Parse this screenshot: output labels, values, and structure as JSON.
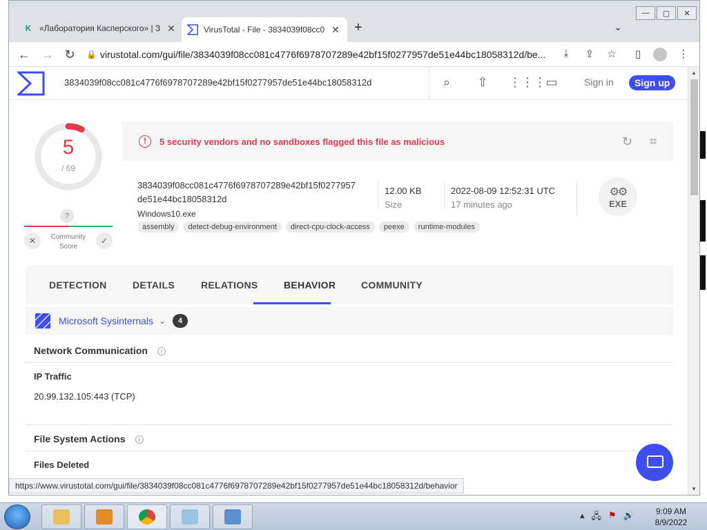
{
  "browser": {
    "tabs": [
      {
        "title": "«Лаборатория Касперского» | З",
        "favicon": "K"
      },
      {
        "title": "VirusTotal - File - 3834039f08cc0",
        "favicon": "vt-logo"
      }
    ],
    "url": "virustotal.com/gui/file/3834039f08cc081c4776f6978707289e42bf15f0277957de51e44bc18058312d/be...",
    "status_url": "https://www.virustotal.com/gui/file/3834039f08cc081c4776f6978707289e42bf15f0277957de51e44bc18058312d/behavior"
  },
  "vt": {
    "search_value": "3834039f08cc081c4776f6978707289e42bf15f0277957de51e44bc18058312d",
    "sign_in": "Sign in",
    "sign_up": "Sign up",
    "score": {
      "detected": "5",
      "total": "/ 69",
      "fraction": 0.072
    },
    "community": {
      "question": "?",
      "label_line1": "Community",
      "label_line2": "Score"
    },
    "alert_text": "5 security vendors and no sandboxes flagged this file as malicious",
    "file": {
      "hash_line1": "3834039f08cc081c4776f6978707289e42bf15f0277957",
      "hash_line2": "de51e44bc18058312d",
      "name": "Windows10.exe",
      "tags": [
        "assembly",
        "detect-debug-environment",
        "direct-cpu-clock-access",
        "peexe",
        "runtime-modules"
      ],
      "size_value": "12.00 KB",
      "size_label": "Size",
      "date_value": "2022-08-09 12:52:31 UTC",
      "date_ago": "17 minutes ago",
      "type_label": "EXE"
    },
    "nav_tabs": [
      "DETECTION",
      "DETAILS",
      "RELATIONS",
      "BEHAVIOR",
      "COMMUNITY"
    ],
    "active_tab": "BEHAVIOR",
    "sandbox": {
      "name": "Microsoft Sysinternals",
      "count": "4"
    },
    "sections": {
      "network_title": "Network Communication",
      "ip_traffic_title": "IP Traffic",
      "ip_traffic_value": "20.99.132.105:443 (TCP)",
      "fs_title": "File System Actions",
      "files_deleted_title": "Files Deleted"
    }
  },
  "taskbar": {
    "time": "9:09 AM",
    "date": "8/9/2022"
  },
  "colors": {
    "accent": "#3d4df0",
    "malicious": "#e5384f"
  }
}
